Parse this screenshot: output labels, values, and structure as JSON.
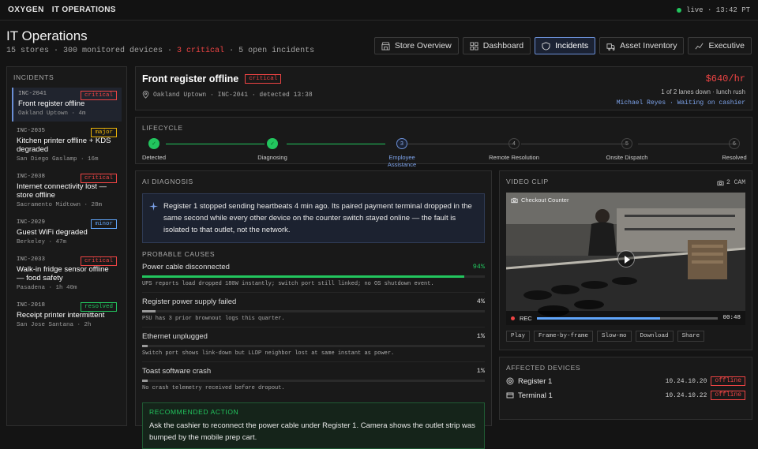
{
  "topbar": {
    "brand": "OXYGEN",
    "section": "IT OPERATIONS",
    "live_status": "live · 13:42 PT"
  },
  "header": {
    "title": "IT Operations",
    "stats_prefix": "15 stores · 300 monitored devices · ",
    "stats_critical": "3 critical",
    "stats_suffix": " · 5 open incidents"
  },
  "nav": [
    {
      "label": "Store Overview",
      "icon": "store-icon"
    },
    {
      "label": "Dashboard",
      "icon": "grid-icon"
    },
    {
      "label": "Incidents",
      "icon": "shield-icon",
      "active": true
    },
    {
      "label": "Asset Inventory",
      "icon": "truck-icon"
    },
    {
      "label": "Executive",
      "icon": "trend-icon"
    }
  ],
  "incidents_panel": {
    "label": "INCIDENTS",
    "items": [
      {
        "id": "INC-2041",
        "title": "Front register offline",
        "meta": "Oakland Uptown · 4m",
        "severity": "critical"
      },
      {
        "id": "INC-2035",
        "title": "Kitchen printer offline + KDS degraded",
        "meta": "San Diego Gaslamp · 16m",
        "severity": "major"
      },
      {
        "id": "INC-2038",
        "title": "Internet connectivity lost — store offline",
        "meta": "Sacramento Midtown · 28m",
        "severity": "critical"
      },
      {
        "id": "INC-2029",
        "title": "Guest WiFi degraded",
        "meta": "Berkeley · 47m",
        "severity": "minor"
      },
      {
        "id": "INC-2033",
        "title": "Walk-in fridge sensor offline — food safety",
        "meta": "Pasadena · 1h 40m",
        "severity": "critical"
      },
      {
        "id": "INC-2018",
        "title": "Receipt printer intermittent",
        "meta": "San Jose Santana · 2h",
        "severity": "resolved"
      }
    ]
  },
  "incident": {
    "title": "Front register offline",
    "severity": "critical",
    "meta": "Oakland Uptown · INC-2041 · detected 13:38",
    "rate": "$640/hr",
    "lanes": "1 of 2 lanes down · lunch rush",
    "owner": "Michael Reyes",
    "owner_status": "Waiting on cashier"
  },
  "lifecycle": {
    "label": "LIFECYCLE",
    "steps": [
      {
        "label": "Detected",
        "num": "✓",
        "state": "done"
      },
      {
        "label": "Diagnosing",
        "num": "✓",
        "state": "done"
      },
      {
        "label": "Employee Assistance",
        "num": "3",
        "state": "current"
      },
      {
        "label": "Remote Resolution",
        "num": "4",
        "state": "todo"
      },
      {
        "label": "Onsite Dispatch",
        "num": "5",
        "state": "todo"
      },
      {
        "label": "Resolved",
        "num": "6",
        "state": "todo"
      }
    ]
  },
  "ai": {
    "label": "AI DIAGNOSIS",
    "summary": "Register 1 stopped sending heartbeats 4 min ago. Its paired payment terminal dropped in the same second while every other device on the counter switch stayed online — the fault is isolated to that outlet, not the network.",
    "causes_label": "PROBABLE CAUSES",
    "causes": [
      {
        "title": "Power cable disconnected",
        "pct": "94%",
        "value": 0.94,
        "note": "UPS reports load dropped 180W instantly; switch port still linked; no OS shutdown event.",
        "color": "#22c55e"
      },
      {
        "title": "Register power supply failed",
        "pct": "4%",
        "value": 0.04,
        "note": "PSU has 3 prior brownout logs this quarter.",
        "color": "#9a9a9a"
      },
      {
        "title": "Ethernet unplugged",
        "pct": "1%",
        "value": 0.01,
        "note": "Switch port shows link-down but LLDP neighbor lost at same instant as power.",
        "color": "#9a9a9a"
      },
      {
        "title": "Toast software crash",
        "pct": "1%",
        "value": 0.01,
        "note": "No crash telemetry received before dropout.",
        "color": "#9a9a9a"
      }
    ],
    "rec_label": "RECOMMENDED ACTION",
    "rec_text": "Ask the cashier to reconnect the power cable under Register 1. Camera shows the outlet strip was bumped by the mobile prep cart."
  },
  "video": {
    "label": "VIDEO CLIP",
    "cam_count": "2 CAM",
    "camera_name": "Checkout Counter",
    "rec": "REC",
    "time": "00:48",
    "progress": 0.68,
    "buttons": [
      "Play",
      "Frame-by-frame",
      "Slow-mo",
      "Download",
      "Share"
    ]
  },
  "devices": {
    "label": "AFFECTED DEVICES",
    "items": [
      {
        "name": "Register 1",
        "ip": "10.24.10.20",
        "status": "offline",
        "icon": "register-icon"
      },
      {
        "name": "Terminal 1",
        "ip": "10.24.10.22",
        "status": "offline",
        "icon": "card-terminal-icon"
      }
    ]
  }
}
